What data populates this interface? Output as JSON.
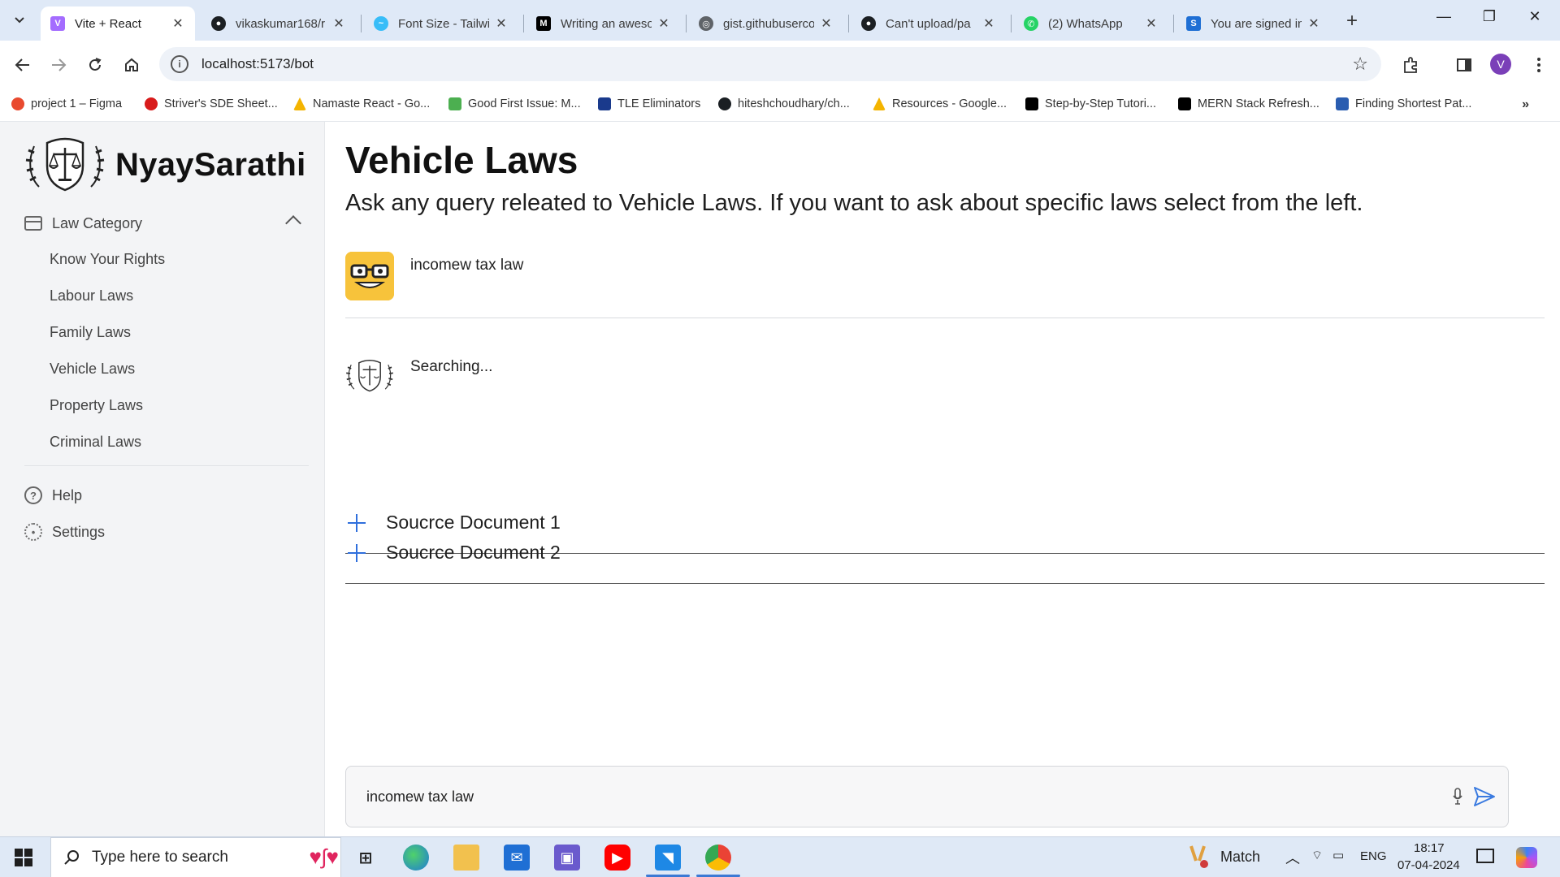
{
  "browser": {
    "tabs": [
      {
        "title": "Vite + React",
        "active": true,
        "favicon": "vite-icon",
        "color": "#a46cff"
      },
      {
        "title": "vikaskumar168/r",
        "active": false,
        "favicon": "github-icon",
        "color": "#1b1f23"
      },
      {
        "title": "Font Size - Tailwi",
        "active": false,
        "favicon": "tailwind-icon",
        "color": "#38bdf8"
      },
      {
        "title": "Writing an aweso",
        "active": false,
        "favicon": "medium-icon",
        "color": "#000000"
      },
      {
        "title": "gist.githubuserco",
        "active": false,
        "favicon": "globe-icon",
        "color": "#5f6368"
      },
      {
        "title": "Can't upload/pa",
        "active": false,
        "favicon": "github-icon",
        "color": "#1b1f23"
      },
      {
        "title": "(2) WhatsApp",
        "active": false,
        "favicon": "whatsapp-icon",
        "color": "#25d366"
      },
      {
        "title": "You are signed in",
        "active": false,
        "favicon": "s-brand-icon",
        "color": "#1f6fd4"
      }
    ],
    "address": "localhost:5173/bot",
    "profile_initial": "V",
    "bookmarks": [
      {
        "label": "project 1 – Figma",
        "color": "#e94a2f"
      },
      {
        "label": "Striver's SDE Sheet...",
        "color": "#d81b1b"
      },
      {
        "label": "Namaste React - Go...",
        "color": "#f4b400"
      },
      {
        "label": "Good First Issue: M...",
        "color": "#4caf50"
      },
      {
        "label": "TLE Eliminators",
        "color": "#1a3a8c"
      },
      {
        "label": "hiteshchoudhary/ch...",
        "color": "#1b1f23"
      },
      {
        "label": "Resources - Google...",
        "color": "#f4b400"
      },
      {
        "label": "Step-by-Step Tutori...",
        "color": "#000000"
      },
      {
        "label": "MERN Stack Refresh...",
        "color": "#000000"
      },
      {
        "label": "Finding Shortest Pat...",
        "color": "#2a5db0"
      }
    ]
  },
  "app": {
    "brand": "NyaySarathi",
    "category_label": "Law Category",
    "categories": [
      "Know Your Rights",
      "Labour Laws",
      "Family Laws",
      "Vehicle Laws",
      "Property Laws",
      "Criminal Laws"
    ],
    "help_label": "Help",
    "settings_label": "Settings",
    "title": "Vehicle Laws",
    "subtitle": "Ask any query releated to Vehicle Laws. If you want to ask about specific laws select from the left.",
    "user_message": "incomew tax law",
    "bot_message": "Searching...",
    "sources": [
      "Soucrce Document 1",
      "Soucrce Document 2"
    ],
    "input_value": "incomew tax law"
  },
  "taskbar": {
    "search_placeholder": "Type here to search",
    "weather": "Match",
    "language": "ENG",
    "time": "18:17",
    "date": "07-04-2024"
  }
}
